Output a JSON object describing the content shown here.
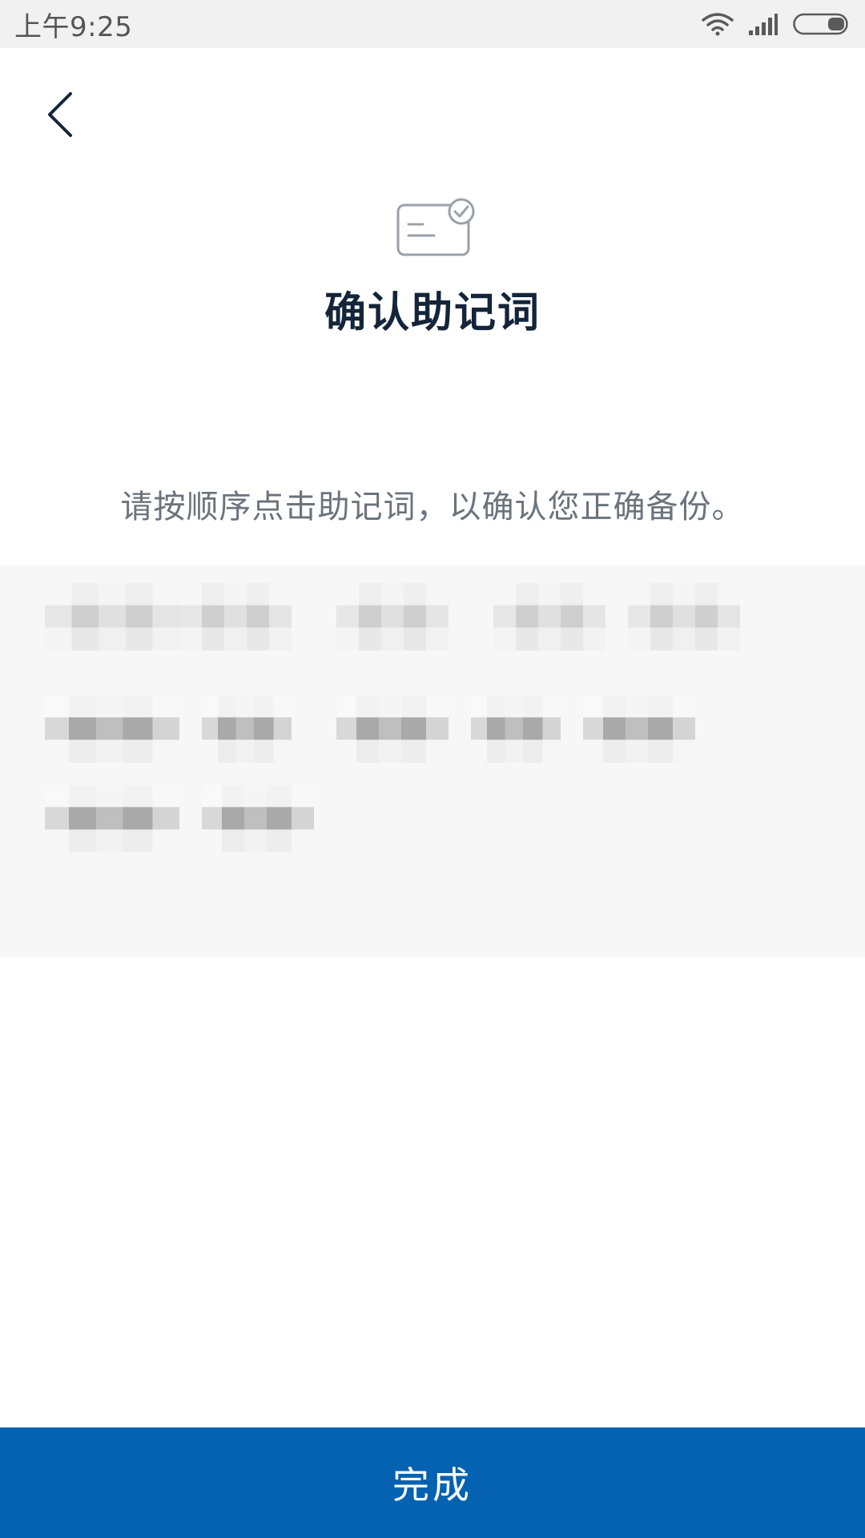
{
  "status_bar": {
    "time": "上午9:25",
    "icons": [
      "wifi-icon",
      "signal-icon",
      "battery-icon"
    ]
  },
  "nav": {
    "back_icon": "chevron-left-icon"
  },
  "header": {
    "icon": "card-check-icon",
    "title": "确认助记词"
  },
  "instruction": "请按顺序点击助记词，以确认您正确备份。",
  "word_panel": {
    "rows": [
      [
        {},
        {},
        {},
        {},
        {}
      ],
      [
        {},
        {},
        {},
        {},
        {}
      ],
      [
        {},
        {}
      ]
    ]
  },
  "footer": {
    "done_label": "完成"
  },
  "colors": {
    "primary": "#0462b0",
    "title": "#14253a",
    "instruction": "#6b737c",
    "status_bar_bg": "#f1f1f1",
    "panel_bg": "#f7f7f7"
  }
}
